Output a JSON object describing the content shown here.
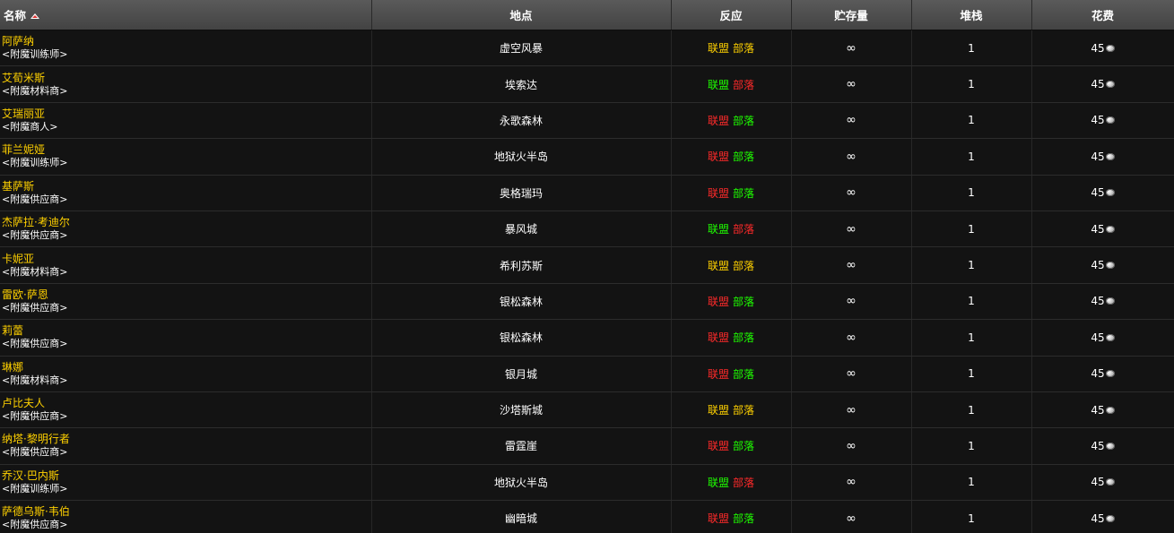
{
  "columns": {
    "name": "名称",
    "location": "地点",
    "reaction": "反应",
    "stock": "贮存量",
    "stack": "堆栈",
    "cost": "花费"
  },
  "sort": {
    "column": "name",
    "direction": "ascending"
  },
  "reaction_labels": {
    "alliance": "联盟",
    "horde": "部落"
  },
  "reaction_colors": {
    "neutral": "#ffd100",
    "friendly": "#1eff00",
    "hostile": "#ff2a2a"
  },
  "icons": {
    "sort": "sort-ascending-icon",
    "currency": "silver-coin-icon"
  },
  "rows": [
    {
      "name": "阿萨纳",
      "title": "<附魔训练师>",
      "location": "虚空风暴",
      "alliance": "neutral",
      "horde": "neutral",
      "stock": "∞",
      "stack": "1",
      "cost": "45"
    },
    {
      "name": "艾荀米斯",
      "title": "<附魔材料商>",
      "location": "埃索达",
      "alliance": "friendly",
      "horde": "hostile",
      "stock": "∞",
      "stack": "1",
      "cost": "45"
    },
    {
      "name": "艾瑞丽亚",
      "title": "<附魔商人>",
      "location": "永歌森林",
      "alliance": "hostile",
      "horde": "friendly",
      "stock": "∞",
      "stack": "1",
      "cost": "45"
    },
    {
      "name": "菲兰妮娅",
      "title": "<附魔训练师>",
      "location": "地狱火半岛",
      "alliance": "hostile",
      "horde": "friendly",
      "stock": "∞",
      "stack": "1",
      "cost": "45"
    },
    {
      "name": "基萨斯",
      "title": "<附魔供应商>",
      "location": "奥格瑞玛",
      "alliance": "hostile",
      "horde": "friendly",
      "stock": "∞",
      "stack": "1",
      "cost": "45"
    },
    {
      "name": "杰萨拉·考迪尔",
      "title": "<附魔供应商>",
      "location": "暴风城",
      "alliance": "friendly",
      "horde": "hostile",
      "stock": "∞",
      "stack": "1",
      "cost": "45"
    },
    {
      "name": "卡妮亚",
      "title": "<附魔材料商>",
      "location": "希利苏斯",
      "alliance": "neutral",
      "horde": "neutral",
      "stock": "∞",
      "stack": "1",
      "cost": "45"
    },
    {
      "name": "雷欧·萨恩",
      "title": "<附魔供应商>",
      "location": "银松森林",
      "alliance": "hostile",
      "horde": "friendly",
      "stock": "∞",
      "stack": "1",
      "cost": "45"
    },
    {
      "name": "莉蕾",
      "title": "<附魔供应商>",
      "location": "银松森林",
      "alliance": "hostile",
      "horde": "friendly",
      "stock": "∞",
      "stack": "1",
      "cost": "45"
    },
    {
      "name": "琳娜",
      "title": "<附魔材料商>",
      "location": "银月城",
      "alliance": "hostile",
      "horde": "friendly",
      "stock": "∞",
      "stack": "1",
      "cost": "45"
    },
    {
      "name": "卢比夫人",
      "title": "<附魔供应商>",
      "location": "沙塔斯城",
      "alliance": "neutral",
      "horde": "neutral",
      "stock": "∞",
      "stack": "1",
      "cost": "45"
    },
    {
      "name": "纳塔·黎明行者",
      "title": "<附魔供应商>",
      "location": "雷霆崖",
      "alliance": "hostile",
      "horde": "friendly",
      "stock": "∞",
      "stack": "1",
      "cost": "45"
    },
    {
      "name": "乔汉·巴内斯",
      "title": "<附魔训练师>",
      "location": "地狱火半岛",
      "alliance": "friendly",
      "horde": "hostile",
      "stock": "∞",
      "stack": "1",
      "cost": "45"
    },
    {
      "name": "萨德乌斯·韦伯",
      "title": "<附魔供应商>",
      "location": "幽暗城",
      "alliance": "hostile",
      "horde": "friendly",
      "stock": "∞",
      "stack": "1",
      "cost": "45"
    }
  ]
}
